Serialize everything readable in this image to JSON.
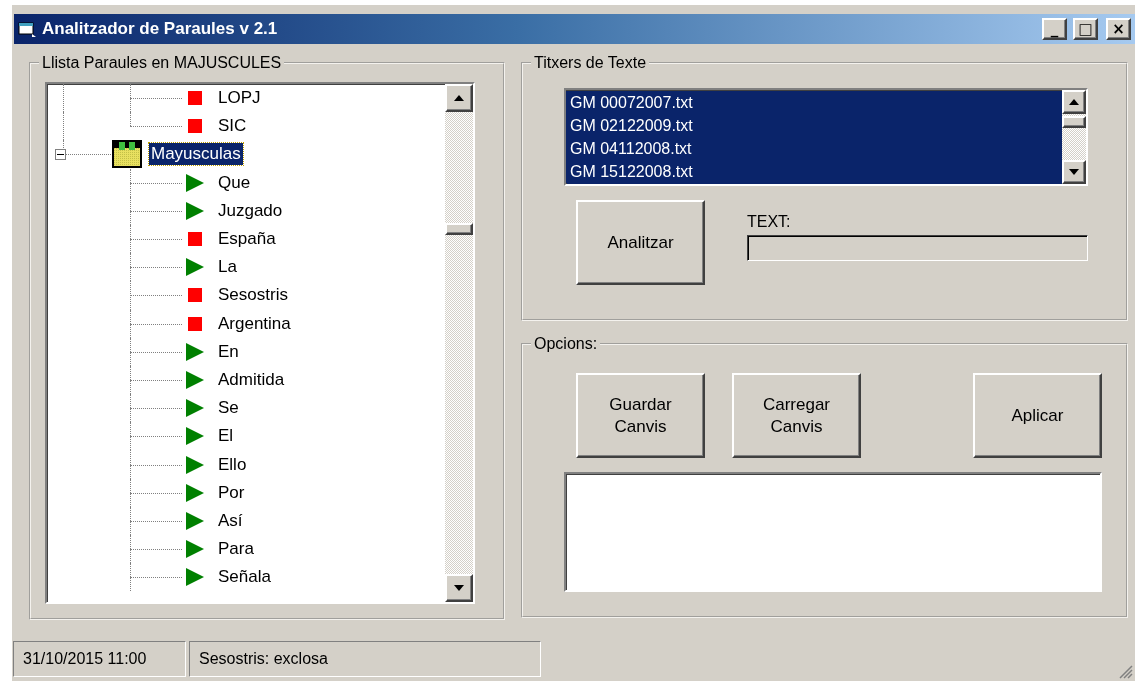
{
  "window": {
    "title": "Analitzador de Paraules v 2.1",
    "controls": [
      "_",
      "□",
      "×"
    ]
  },
  "words_group": {
    "title": "Llista Paraules en MAJUSCULES",
    "tree": [
      {
        "children": [
          {
            "kind": "square",
            "label": "LOPJ"
          },
          {
            "kind": "square",
            "label": "SIC"
          }
        ]
      },
      {
        "kind": "folder",
        "label": "Mayusculas",
        "expanded": true,
        "selected": true,
        "children": [
          {
            "kind": "arrow",
            "label": "Que"
          },
          {
            "kind": "arrow",
            "label": "Juzgado"
          },
          {
            "kind": "square",
            "label": "España"
          },
          {
            "kind": "arrow",
            "label": "La"
          },
          {
            "kind": "square",
            "label": "Sesostris"
          },
          {
            "kind": "square",
            "label": "Argentina"
          },
          {
            "kind": "arrow",
            "label": "En"
          },
          {
            "kind": "arrow",
            "label": "Admitida"
          },
          {
            "kind": "arrow",
            "label": "Se"
          },
          {
            "kind": "arrow",
            "label": "El"
          },
          {
            "kind": "arrow",
            "label": "Ello"
          },
          {
            "kind": "arrow",
            "label": "Por"
          },
          {
            "kind": "arrow",
            "label": "Así"
          },
          {
            "kind": "arrow",
            "label": "Para"
          },
          {
            "kind": "arrow",
            "label": "Señala"
          }
        ]
      }
    ]
  },
  "files_group": {
    "title": "Titxers de Texte",
    "files": [
      {
        "name": "GM 00072007.txt",
        "selected": true
      },
      {
        "name": "GM 02122009.txt",
        "selected": true
      },
      {
        "name": "GM 04112008.txt",
        "selected": true
      },
      {
        "name": "GM 15122008.txt",
        "selected": true
      }
    ],
    "analyze_button": "Analitzar",
    "progress_label": "TEXT:",
    "progress": {
      "level": 0
    }
  },
  "options_group": {
    "title": "Opcions:",
    "buttons": [
      "Guardar Canvis",
      "Carregar Canvis",
      "Aplicar"
    ]
  },
  "status_bar": [
    "31/10/2015 11:00",
    "Sesostris: exclosa"
  ]
}
